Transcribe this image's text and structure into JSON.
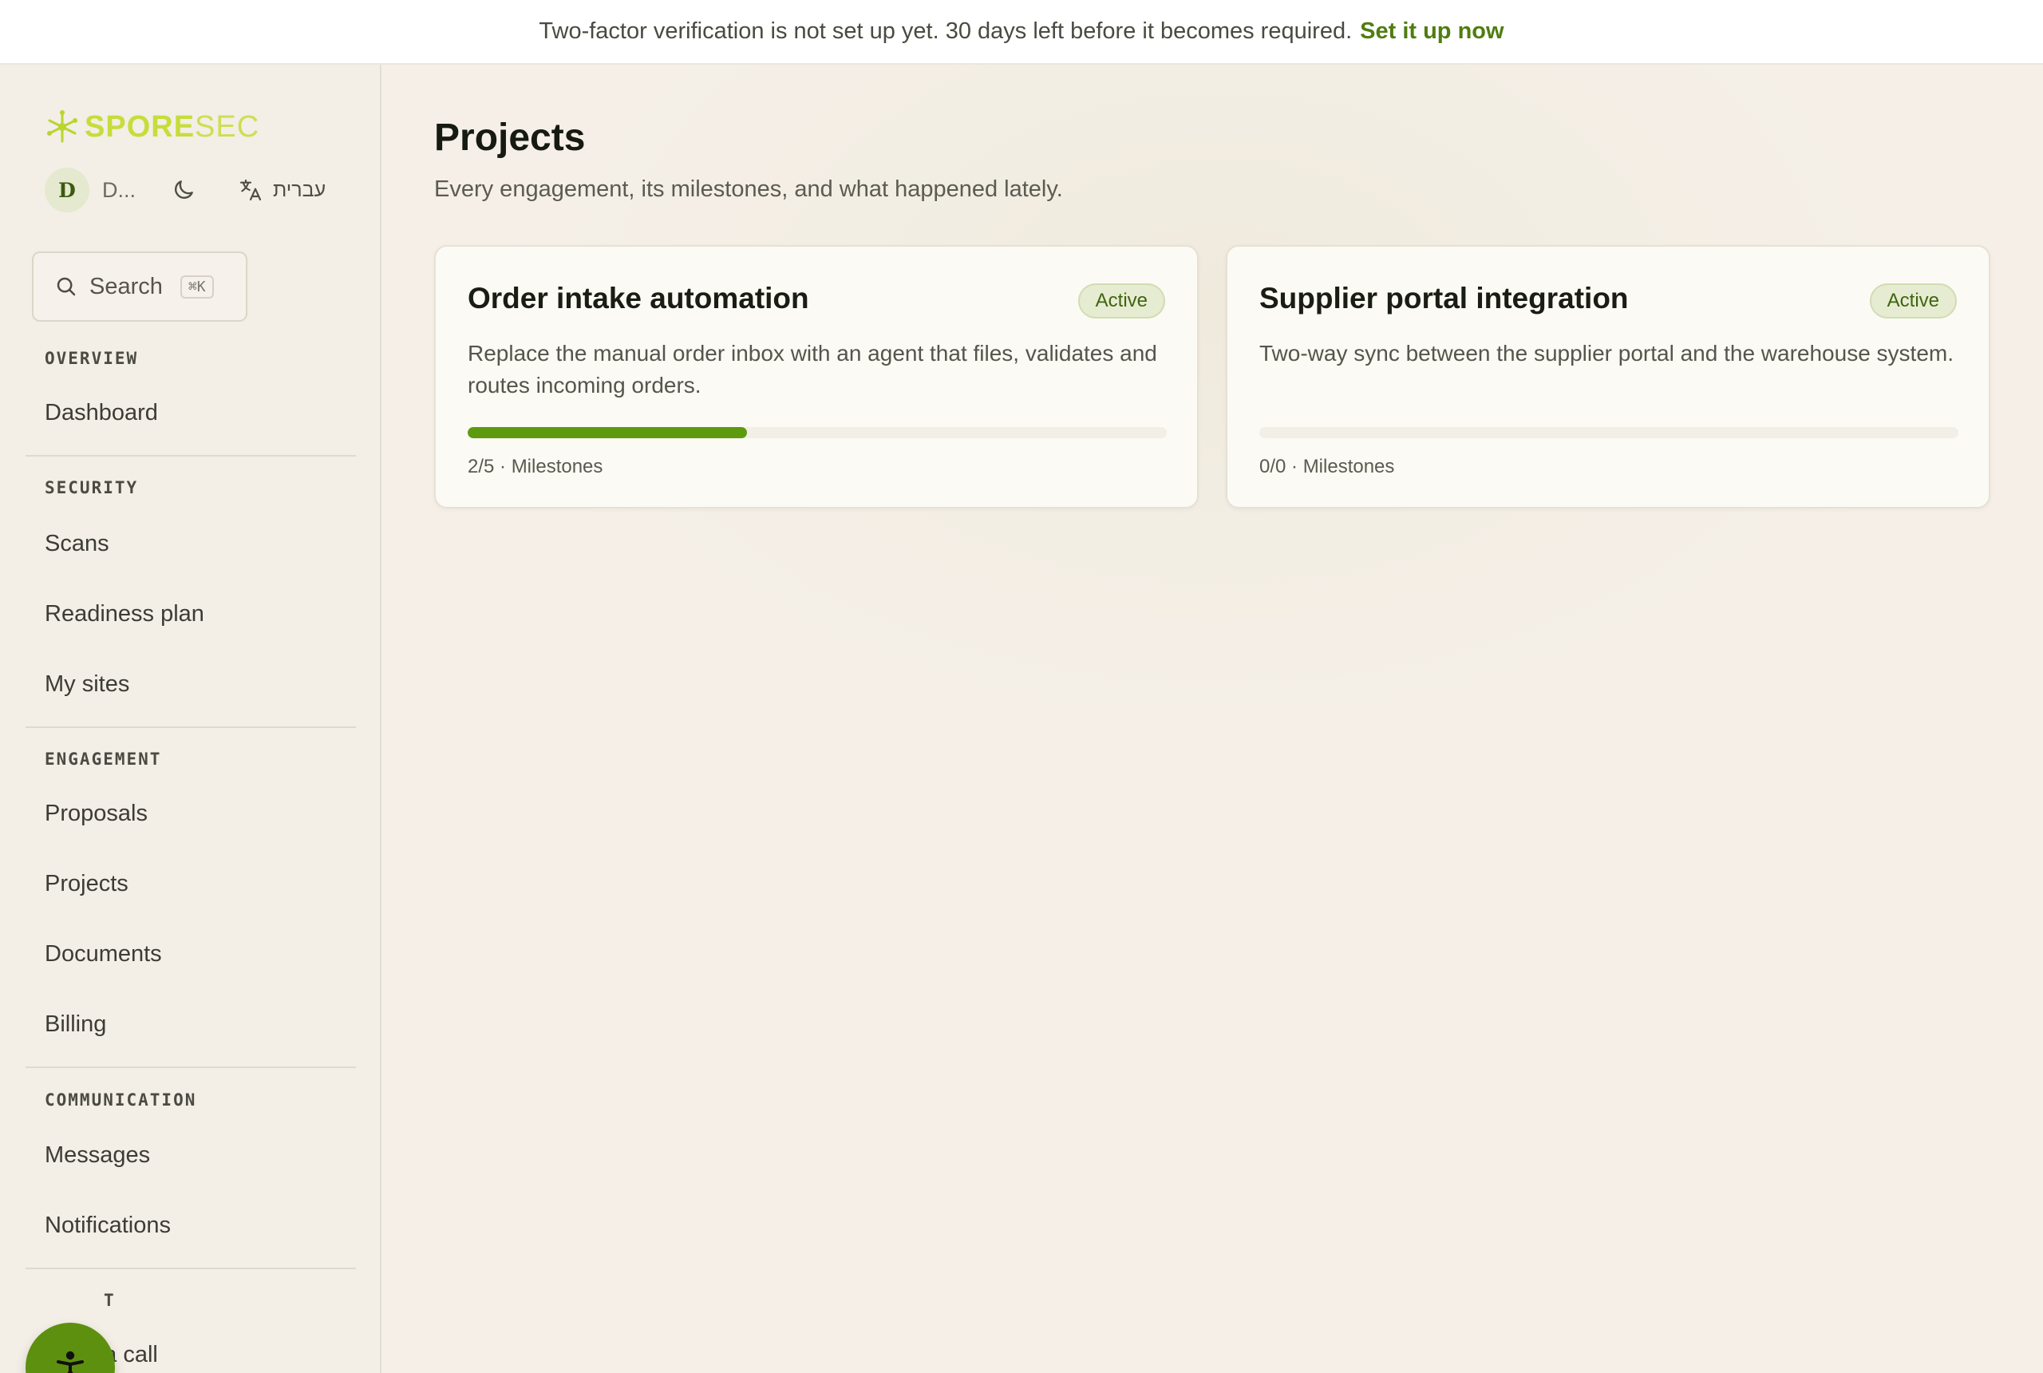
{
  "banner": {
    "message": "Two-factor verification is not set up yet. 30 days left before it becomes required.",
    "link_label": "Set it up now"
  },
  "sidebar": {
    "logo_bold": "SPORE",
    "logo_light": "SEC",
    "user": {
      "avatar_initial": "D",
      "name": "D..."
    },
    "language_label": "עברית",
    "search": {
      "label": "Search",
      "shortcut": "⌘K"
    },
    "sections": [
      {
        "title": "OVERVIEW",
        "items": [
          "Dashboard"
        ]
      },
      {
        "title": "SECURITY",
        "items": [
          "Scans",
          "Readiness plan",
          "My sites"
        ]
      },
      {
        "title": "ENGAGEMENT",
        "items": [
          "Proposals",
          "Projects",
          "Documents",
          "Billing"
        ]
      },
      {
        "title": "COMMUNICATION",
        "items": [
          "Messages",
          "Notifications"
        ]
      },
      {
        "title": "T",
        "items": [
          "Book a call"
        ]
      }
    ]
  },
  "main": {
    "title": "Projects",
    "subtitle": "Every engagement, its milestones, and what happened lately.",
    "projects": [
      {
        "title": "Order intake automation",
        "status": "Active",
        "description": "Replace the manual order inbox with an agent that files, validates and routes incoming orders.",
        "progress": 0.4,
        "milestones_label": "2/5 · Milestones"
      },
      {
        "title": "Supplier portal integration",
        "status": "Active",
        "description": "Two-way sync between the supplier portal and the warehouse system.",
        "progress": 0,
        "milestones_label": "0/0 · Milestones"
      }
    ]
  },
  "colors": {
    "accent": "#5e9a0e",
    "link": "#4f7d0f",
    "logo": "#c6dd3a",
    "badge_bg": "#e6ecd1"
  },
  "icons": [
    "logo-spore-icon",
    "moon-icon",
    "translate-icon",
    "search-icon",
    "accessibility-icon"
  ]
}
